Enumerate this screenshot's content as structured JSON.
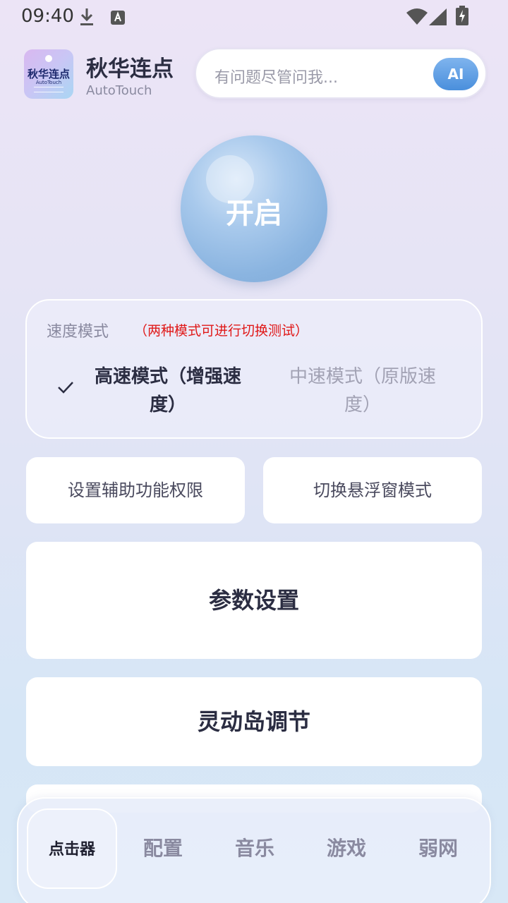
{
  "status_bar": {
    "time": "09:40"
  },
  "header": {
    "logo_text": "秋华连点",
    "logo_sub": "AutoTouch",
    "title": "秋华连点",
    "subtitle": "AutoTouch",
    "search_placeholder": "有问题尽管问我...",
    "ai_button": "AI"
  },
  "start_button": {
    "label": "开启"
  },
  "speed_mode": {
    "title": "速度模式",
    "hint": "（两种模式可进行切换测试）",
    "options": [
      {
        "label": "高速模式（增强速度）",
        "selected": true
      },
      {
        "label": "中速模式（原版速度）",
        "selected": false
      }
    ]
  },
  "actions": {
    "accessibility": "设置辅助功能权限",
    "floating_mode": "切换悬浮窗模式",
    "params": "参数设置",
    "island": "灵动岛调节"
  },
  "bottom_nav": {
    "items": [
      {
        "label": "点击器",
        "active": true
      },
      {
        "label": "配置",
        "active": false
      },
      {
        "label": "音乐",
        "active": false
      },
      {
        "label": "游戏",
        "active": false
      },
      {
        "label": "弱网",
        "active": false
      }
    ]
  },
  "colors": {
    "accent": "#4a8fdc",
    "hint": "#e01818"
  },
  "icons": [
    "download-icon",
    "keyboard-a-icon",
    "wifi-icon",
    "signal-icon",
    "battery-charging-icon",
    "check-icon"
  ]
}
